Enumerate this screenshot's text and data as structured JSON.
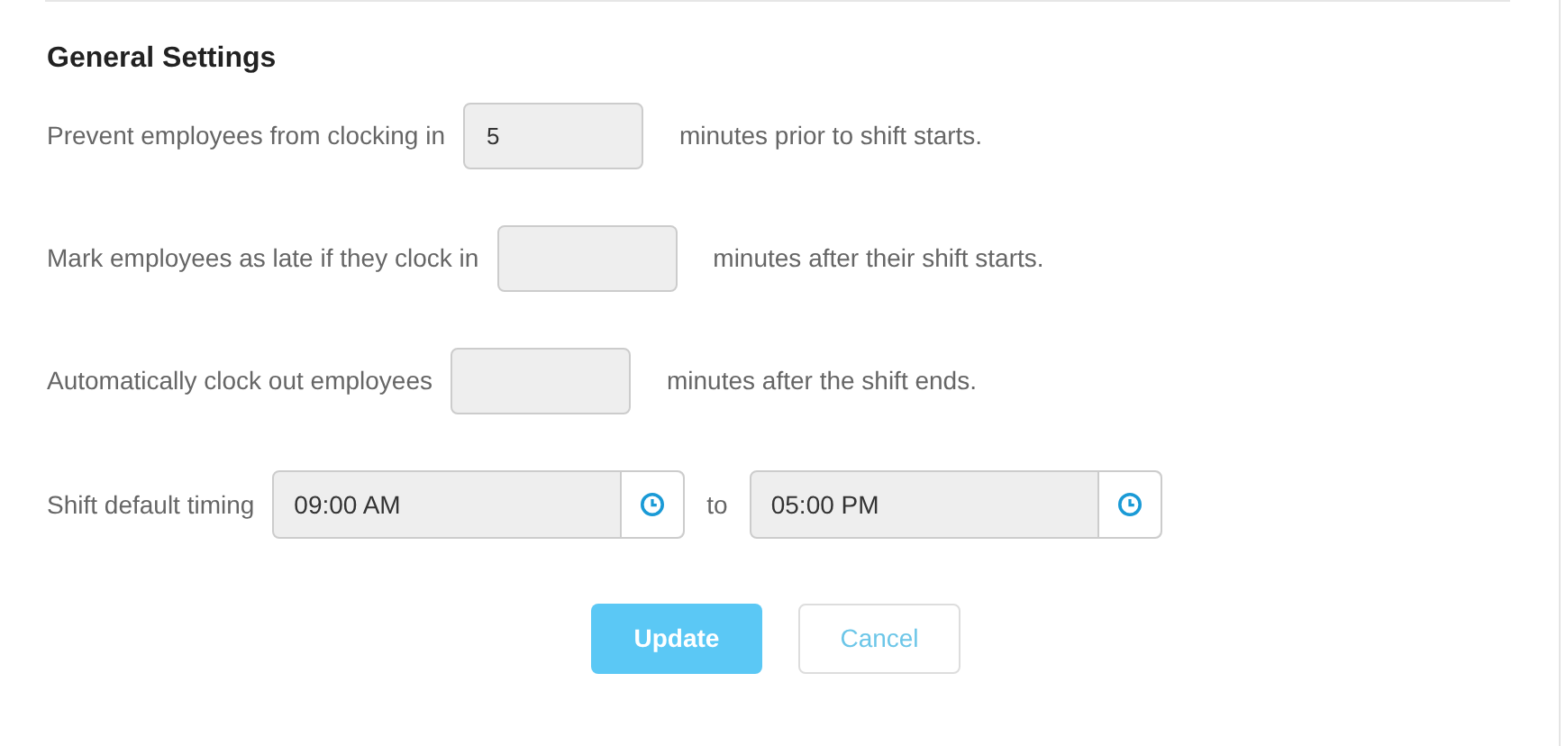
{
  "section": {
    "title": "General Settings"
  },
  "rows": [
    {
      "kind": "minutes",
      "label": "Prevent employees from clocking in",
      "value": "5",
      "suffix": "minutes prior to shift starts."
    },
    {
      "kind": "minutes",
      "label": "Mark employees as late if they clock in",
      "suffix": "minutes after their shift starts."
    },
    {
      "kind": "minutes",
      "label": "Automatically clock out employees",
      "suffix": "minutes after the shift ends."
    },
    {
      "kind": "timing",
      "label": "Shift default timing",
      "start": "09:00 AM",
      "separator": "to",
      "end": "05:00 PM"
    }
  ],
  "buttons": {
    "update": "Update",
    "cancel": "Cancel"
  }
}
